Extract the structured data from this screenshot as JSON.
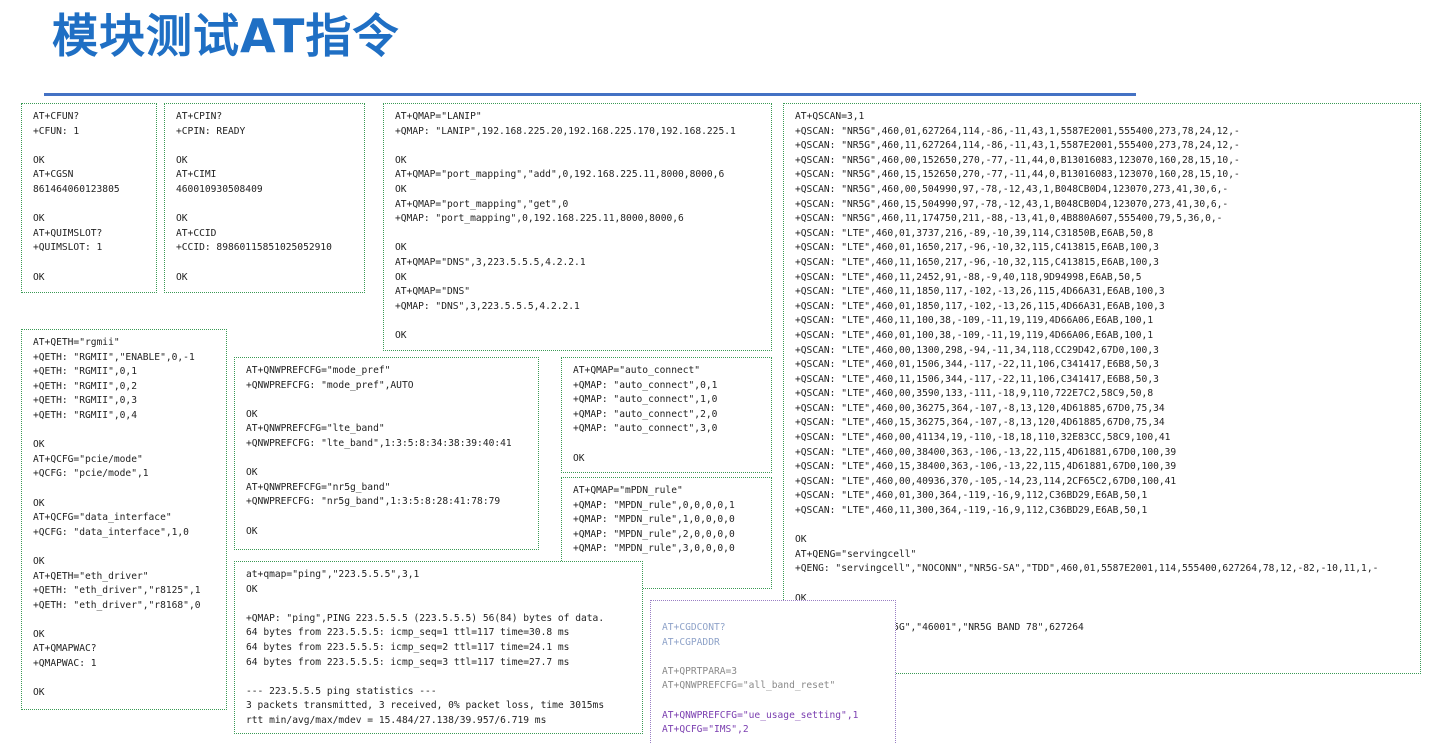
{
  "title": "模块测试AT指令",
  "boxes": {
    "cfun": [
      "AT+CFUN?",
      "+CFUN: 1",
      "",
      "OK",
      "AT+CGSN",
      "861464060123805",
      "",
      "OK",
      "AT+QUIMSLOT?",
      "+QUIMSLOT: 1",
      "",
      "OK"
    ],
    "cpin": [
      "AT+CPIN?",
      "+CPIN: READY",
      "",
      "OK",
      "AT+CIMI",
      "460010930508409",
      "",
      "OK",
      "AT+CCID",
      "+CCID: 89860115851025052910",
      "",
      "OK"
    ],
    "qmap_lanip": [
      "AT+QMAP=\"LANIP\"",
      "+QMAP: \"LANIP\",192.168.225.20,192.168.225.170,192.168.225.1",
      "",
      "OK",
      "AT+QMAP=\"port_mapping\",\"add\",0,192.168.225.11,8000,8000,6",
      "OK",
      "AT+QMAP=\"port_mapping\",\"get\",0",
      "+QMAP: \"port_mapping\",0,192.168.225.11,8000,8000,6",
      "",
      "OK",
      "AT+QMAP=\"DNS\",3,223.5.5.5,4.2.2.1",
      "OK",
      "AT+QMAP=\"DNS\"",
      "+QMAP: \"DNS\",3,223.5.5.5,4.2.2.1",
      "",
      "OK"
    ],
    "qeth": [
      "AT+QETH=\"rgmii\"",
      "+QETH: \"RGMII\",\"ENABLE\",0,-1",
      "+QETH: \"RGMII\",0,1",
      "+QETH: \"RGMII\",0,2",
      "+QETH: \"RGMII\",0,3",
      "+QETH: \"RGMII\",0,4",
      "",
      "OK",
      "AT+QCFG=\"pcie/mode\"",
      "+QCFG: \"pcie/mode\",1",
      "",
      "OK",
      "AT+QCFG=\"data_interface\"",
      "+QCFG: \"data_interface\",1,0",
      "",
      "OK",
      "AT+QETH=\"eth_driver\"",
      "+QETH: \"eth_driver\",\"r8125\",1",
      "+QETH: \"eth_driver\",\"r8168\",0",
      "",
      "OK",
      "AT+QMAPWAC?",
      "+QMAPWAC: 1",
      "",
      "OK"
    ],
    "nwprefcfg": [
      "AT+QNWPREFCFG=\"mode_pref\"",
      "+QNWPREFCFG: \"mode_pref\",AUTO",
      "",
      "OK",
      "AT+QNWPREFCFG=\"lte_band\"",
      "+QNWPREFCFG: \"lte_band\",1:3:5:8:34:38:39:40:41",
      "",
      "OK",
      "AT+QNWPREFCFG=\"nr5g_band\"",
      "+QNWPREFCFG: \"nr5g_band\",1:3:5:8:28:41:78:79",
      "",
      "OK"
    ],
    "auto_connect": [
      "AT+QMAP=\"auto_connect\"",
      "+QMAP: \"auto_connect\",0,1",
      "+QMAP: \"auto_connect\",1,0",
      "+QMAP: \"auto_connect\",2,0",
      "+QMAP: \"auto_connect\",3,0",
      "",
      "OK"
    ],
    "mpdn_rule": [
      "AT+QMAP=\"mPDN_rule\"",
      "+QMAP: \"MPDN_rule\",0,0,0,0,1",
      "+QMAP: \"MPDN_rule\",1,0,0,0,0",
      "+QMAP: \"MPDN_rule\",2,0,0,0,0",
      "+QMAP: \"MPDN_rule\",3,0,0,0,0",
      "",
      "OK"
    ],
    "ping": [
      "at+qmap=\"ping\",\"223.5.5.5\",3,1",
      "OK",
      "",
      "+QMAP: \"ping\",PING 223.5.5.5 (223.5.5.5) 56(84) bytes of data.",
      "64 bytes from 223.5.5.5: icmp_seq=1 ttl=117 time=30.8 ms",
      "64 bytes from 223.5.5.5: icmp_seq=2 ttl=117 time=24.1 ms",
      "64 bytes from 223.5.5.5: icmp_seq=3 ttl=117 time=27.7 ms",
      "",
      "--- 223.5.5.5 ping statistics ---",
      "3 packets transmitted, 3 received, 0% packet loss, time 3015ms",
      "rtt min/avg/max/mdev = 15.484/27.138/39.957/6.719 ms"
    ],
    "bottom": [
      "AT+CGDCONT?",
      "AT+CGPADDR",
      "",
      "AT+QPRTPARA=3",
      "AT+QNWPREFCFG=\"all_band_reset\"",
      "",
      "AT+QNWPREFCFG=\"ue_usage_setting\",1",
      "AT+QCFG=\"IMS\",2"
    ],
    "qscan": [
      "AT+QSCAN=3,1",
      "+QSCAN: \"NR5G\",460,01,627264,114,-86,-11,43,1,5587E2001,555400,273,78,24,12,-",
      "+QSCAN: \"NR5G\",460,11,627264,114,-86,-11,43,1,5587E2001,555400,273,78,24,12,-",
      "+QSCAN: \"NR5G\",460,00,152650,270,-77,-11,44,0,B13016083,123070,160,28,15,10,-",
      "+QSCAN: \"NR5G\",460,15,152650,270,-77,-11,44,0,B13016083,123070,160,28,15,10,-",
      "+QSCAN: \"NR5G\",460,00,504990,97,-78,-12,43,1,B048CB0D4,123070,273,41,30,6,-",
      "+QSCAN: \"NR5G\",460,15,504990,97,-78,-12,43,1,B048CB0D4,123070,273,41,30,6,-",
      "+QSCAN: \"NR5G\",460,11,174750,211,-88,-13,41,0,4B880A607,555400,79,5,36,0,-",
      "+QSCAN: \"LTE\",460,01,3737,216,-89,-10,39,114,C31850B,E6AB,50,8",
      "+QSCAN: \"LTE\",460,01,1650,217,-96,-10,32,115,C413815,E6AB,100,3",
      "+QSCAN: \"LTE\",460,11,1650,217,-96,-10,32,115,C413815,E6AB,100,3",
      "+QSCAN: \"LTE\",460,11,2452,91,-88,-9,40,118,9D94998,E6AB,50,5",
      "+QSCAN: \"LTE\",460,11,1850,117,-102,-13,26,115,4D66A31,E6AB,100,3",
      "+QSCAN: \"LTE\",460,01,1850,117,-102,-13,26,115,4D66A31,E6AB,100,3",
      "+QSCAN: \"LTE\",460,11,100,38,-109,-11,19,119,4D66A06,E6AB,100,1",
      "+QSCAN: \"LTE\",460,01,100,38,-109,-11,19,119,4D66A06,E6AB,100,1",
      "+QSCAN: \"LTE\",460,00,1300,298,-94,-11,34,118,CC29D42,67D0,100,3",
      "+QSCAN: \"LTE\",460,01,1506,344,-117,-22,11,106,C341417,E6B8,50,3",
      "+QSCAN: \"LTE\",460,11,1506,344,-117,-22,11,106,C341417,E6B8,50,3",
      "+QSCAN: \"LTE\",460,00,3590,133,-111,-18,9,110,722E7C2,58C9,50,8",
      "+QSCAN: \"LTE\",460,00,36275,364,-107,-8,13,120,4D61885,67D0,75,34",
      "+QSCAN: \"LTE\",460,15,36275,364,-107,-8,13,120,4D61885,67D0,75,34",
      "+QSCAN: \"LTE\",460,00,41134,19,-110,-18,18,110,32E83CC,58C9,100,41",
      "+QSCAN: \"LTE\",460,00,38400,363,-106,-13,22,115,4D61881,67D0,100,39",
      "+QSCAN: \"LTE\",460,15,38400,363,-106,-13,22,115,4D61881,67D0,100,39",
      "+QSCAN: \"LTE\",460,00,40936,370,-105,-14,23,114,2CF65C2,67D0,100,41",
      "+QSCAN: \"LTE\",460,01,300,364,-119,-16,9,112,C36BD29,E6AB,50,1",
      "+QSCAN: \"LTE\",460,11,300,364,-119,-16,9,112,C36BD29,E6AB,50,1",
      "",
      "OK",
      "AT+QENG=\"servingcell\"",
      "+QENG: \"servingcell\",\"NOCONN\",\"NR5G-SA\",\"TDD\",460,01,5587E2001,114,555400,627264,78,12,-82,-10,11,1,-",
      "",
      "OK",
      "at+qnwinfo",
      "+QNWINFO: \"TDD NR5G\",\"46001\",\"NR5G BAND 78\",627264",
      "",
      "OK"
    ]
  }
}
